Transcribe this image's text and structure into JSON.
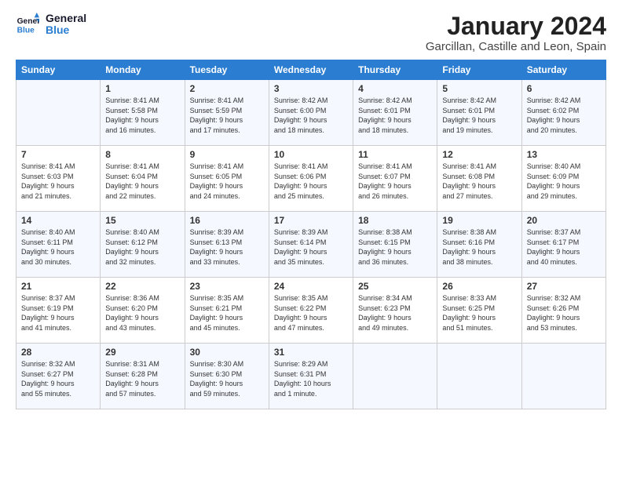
{
  "logo": {
    "line1": "General",
    "line2": "Blue"
  },
  "title": "January 2024",
  "location": "Garcillan, Castille and Leon, Spain",
  "weekdays": [
    "Sunday",
    "Monday",
    "Tuesday",
    "Wednesday",
    "Thursday",
    "Friday",
    "Saturday"
  ],
  "weeks": [
    [
      {
        "day": "",
        "content": ""
      },
      {
        "day": "1",
        "content": "Sunrise: 8:41 AM\nSunset: 5:58 PM\nDaylight: 9 hours\nand 16 minutes."
      },
      {
        "day": "2",
        "content": "Sunrise: 8:41 AM\nSunset: 5:59 PM\nDaylight: 9 hours\nand 17 minutes."
      },
      {
        "day": "3",
        "content": "Sunrise: 8:42 AM\nSunset: 6:00 PM\nDaylight: 9 hours\nand 18 minutes."
      },
      {
        "day": "4",
        "content": "Sunrise: 8:42 AM\nSunset: 6:01 PM\nDaylight: 9 hours\nand 18 minutes."
      },
      {
        "day": "5",
        "content": "Sunrise: 8:42 AM\nSunset: 6:01 PM\nDaylight: 9 hours\nand 19 minutes."
      },
      {
        "day": "6",
        "content": "Sunrise: 8:42 AM\nSunset: 6:02 PM\nDaylight: 9 hours\nand 20 minutes."
      }
    ],
    [
      {
        "day": "7",
        "content": "Sunrise: 8:41 AM\nSunset: 6:03 PM\nDaylight: 9 hours\nand 21 minutes."
      },
      {
        "day": "8",
        "content": "Sunrise: 8:41 AM\nSunset: 6:04 PM\nDaylight: 9 hours\nand 22 minutes."
      },
      {
        "day": "9",
        "content": "Sunrise: 8:41 AM\nSunset: 6:05 PM\nDaylight: 9 hours\nand 24 minutes."
      },
      {
        "day": "10",
        "content": "Sunrise: 8:41 AM\nSunset: 6:06 PM\nDaylight: 9 hours\nand 25 minutes."
      },
      {
        "day": "11",
        "content": "Sunrise: 8:41 AM\nSunset: 6:07 PM\nDaylight: 9 hours\nand 26 minutes."
      },
      {
        "day": "12",
        "content": "Sunrise: 8:41 AM\nSunset: 6:08 PM\nDaylight: 9 hours\nand 27 minutes."
      },
      {
        "day": "13",
        "content": "Sunrise: 8:40 AM\nSunset: 6:09 PM\nDaylight: 9 hours\nand 29 minutes."
      }
    ],
    [
      {
        "day": "14",
        "content": "Sunrise: 8:40 AM\nSunset: 6:11 PM\nDaylight: 9 hours\nand 30 minutes."
      },
      {
        "day": "15",
        "content": "Sunrise: 8:40 AM\nSunset: 6:12 PM\nDaylight: 9 hours\nand 32 minutes."
      },
      {
        "day": "16",
        "content": "Sunrise: 8:39 AM\nSunset: 6:13 PM\nDaylight: 9 hours\nand 33 minutes."
      },
      {
        "day": "17",
        "content": "Sunrise: 8:39 AM\nSunset: 6:14 PM\nDaylight: 9 hours\nand 35 minutes."
      },
      {
        "day": "18",
        "content": "Sunrise: 8:38 AM\nSunset: 6:15 PM\nDaylight: 9 hours\nand 36 minutes."
      },
      {
        "day": "19",
        "content": "Sunrise: 8:38 AM\nSunset: 6:16 PM\nDaylight: 9 hours\nand 38 minutes."
      },
      {
        "day": "20",
        "content": "Sunrise: 8:37 AM\nSunset: 6:17 PM\nDaylight: 9 hours\nand 40 minutes."
      }
    ],
    [
      {
        "day": "21",
        "content": "Sunrise: 8:37 AM\nSunset: 6:19 PM\nDaylight: 9 hours\nand 41 minutes."
      },
      {
        "day": "22",
        "content": "Sunrise: 8:36 AM\nSunset: 6:20 PM\nDaylight: 9 hours\nand 43 minutes."
      },
      {
        "day": "23",
        "content": "Sunrise: 8:35 AM\nSunset: 6:21 PM\nDaylight: 9 hours\nand 45 minutes."
      },
      {
        "day": "24",
        "content": "Sunrise: 8:35 AM\nSunset: 6:22 PM\nDaylight: 9 hours\nand 47 minutes."
      },
      {
        "day": "25",
        "content": "Sunrise: 8:34 AM\nSunset: 6:23 PM\nDaylight: 9 hours\nand 49 minutes."
      },
      {
        "day": "26",
        "content": "Sunrise: 8:33 AM\nSunset: 6:25 PM\nDaylight: 9 hours\nand 51 minutes."
      },
      {
        "day": "27",
        "content": "Sunrise: 8:32 AM\nSunset: 6:26 PM\nDaylight: 9 hours\nand 53 minutes."
      }
    ],
    [
      {
        "day": "28",
        "content": "Sunrise: 8:32 AM\nSunset: 6:27 PM\nDaylight: 9 hours\nand 55 minutes."
      },
      {
        "day": "29",
        "content": "Sunrise: 8:31 AM\nSunset: 6:28 PM\nDaylight: 9 hours\nand 57 minutes."
      },
      {
        "day": "30",
        "content": "Sunrise: 8:30 AM\nSunset: 6:30 PM\nDaylight: 9 hours\nand 59 minutes."
      },
      {
        "day": "31",
        "content": "Sunrise: 8:29 AM\nSunset: 6:31 PM\nDaylight: 10 hours\nand 1 minute."
      },
      {
        "day": "",
        "content": ""
      },
      {
        "day": "",
        "content": ""
      },
      {
        "day": "",
        "content": ""
      }
    ]
  ]
}
